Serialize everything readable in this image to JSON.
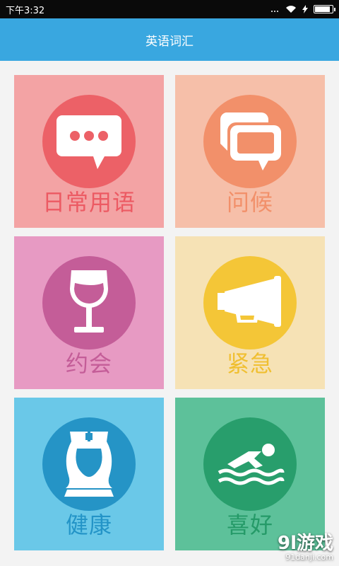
{
  "statusbar": {
    "time": "下午3:32"
  },
  "appbar": {
    "title": "英语词汇"
  },
  "tiles": [
    {
      "label": "日常用语",
      "icon": "chat-dots-icon"
    },
    {
      "label": "问候",
      "icon": "speech-bubbles-icon"
    },
    {
      "label": "约会",
      "icon": "wine-glass-icon"
    },
    {
      "label": "紧急",
      "icon": "megaphone-icon"
    },
    {
      "label": "健康",
      "icon": "nurse-icon"
    },
    {
      "label": "喜好",
      "icon": "swimmer-icon"
    }
  ],
  "watermark": {
    "main": "9l游戏",
    "sub": "91danji.com"
  }
}
